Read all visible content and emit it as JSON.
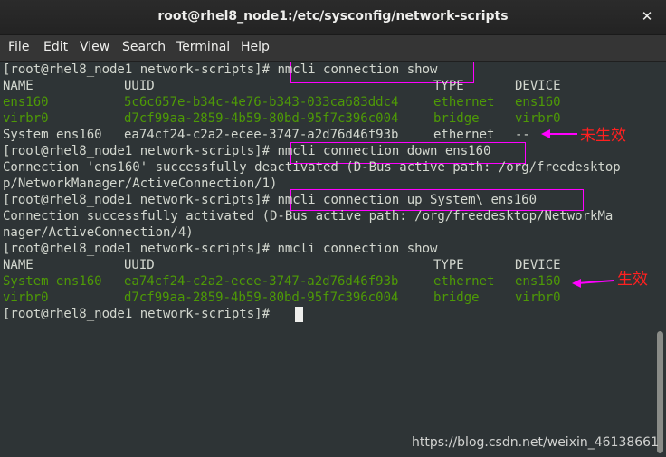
{
  "window": {
    "title": "root@rhel8_node1:/etc/sysconfig/network-scripts",
    "close_glyph": "✕"
  },
  "menu": [
    "File",
    "Edit",
    "View",
    "Search",
    "Terminal",
    "Help"
  ],
  "terminal": {
    "lines": [
      {
        "type": "prompt",
        "prompt": "[root@rhel8_node1 network-scripts]# ",
        "cmd": "nmcli connection show"
      },
      {
        "type": "row",
        "cols": [
          "NAME",
          "UUID",
          "TYPE",
          "DEVICE"
        ]
      },
      {
        "type": "row_green",
        "cols": [
          "ens160",
          "5c6c657e-b34c-4e76-b343-033ca683ddc4",
          "ethernet",
          "ens160"
        ]
      },
      {
        "type": "row_green",
        "cols": [
          "virbr0",
          "d7cf99aa-2859-4b59-80bd-95f7c396c004",
          "bridge",
          "virbr0"
        ]
      },
      {
        "type": "row",
        "cols": [
          "System ens160",
          "ea74cf24-c2a2-ecee-3747-a2d76d46f93b",
          "ethernet",
          "--"
        ]
      },
      {
        "type": "prompt",
        "prompt": "[root@rhel8_node1 network-scripts]# ",
        "cmd": "nmcli connection down ens160"
      },
      {
        "type": "text",
        "text": "Connection 'ens160' successfully deactivated (D-Bus active path: /org/freedesktop"
      },
      {
        "type": "text",
        "text": "p/NetworkManager/ActiveConnection/1)"
      },
      {
        "type": "prompt",
        "prompt": "[root@rhel8_node1 network-scripts]# ",
        "cmd": "nmcli connection up System\\ ens160"
      },
      {
        "type": "text",
        "text": "Connection successfully activated (D-Bus active path: /org/freedesktop/NetworkMa"
      },
      {
        "type": "text",
        "text": "nager/ActiveConnection/4)"
      },
      {
        "type": "prompt",
        "prompt": "[root@rhel8_node1 network-scripts]# ",
        "cmd": "nmcli connection show"
      },
      {
        "type": "row",
        "cols": [
          "NAME",
          "UUID",
          "TYPE",
          "DEVICE"
        ]
      },
      {
        "type": "row_green",
        "cols": [
          "System ens160",
          "ea74cf24-c2a2-ecee-3747-a2d76d46f93b",
          "ethernet",
          "ens160"
        ]
      },
      {
        "type": "row_green",
        "cols": [
          "virbr0",
          "d7cf99aa-2859-4b59-80bd-95f7c396c004",
          "bridge",
          "virbr0"
        ]
      },
      {
        "type": "prompt",
        "prompt": "[root@rhel8_node1 network-scripts]# ",
        "cmd": "",
        "cursor": true
      }
    ]
  },
  "annotations": {
    "not_effective": "未生效",
    "effective": "生效"
  },
  "watermark": "https://blog.csdn.net/weixin_46138661",
  "colors": {
    "background": "#2e3436",
    "text": "#d3d7cf",
    "green": "#4e9a06",
    "box": "#ff00ff",
    "annotation": "#ff2020"
  }
}
